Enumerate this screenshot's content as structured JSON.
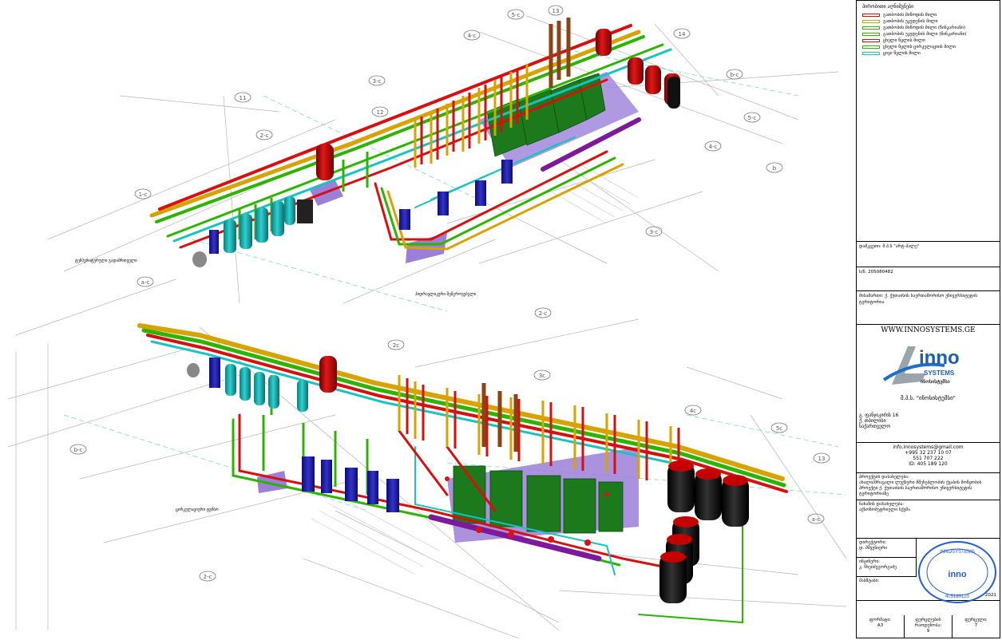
{
  "legend": {
    "title": "პირობითი აღნიშვნები",
    "items": [
      {
        "label": "გათბობის მიწოდის მილი",
        "color": "#d80f0f"
      },
      {
        "label": "გათბობის უკუდენის მილი",
        "color": "#d6a300"
      },
      {
        "label": "გათბობის მიწოდის მილი (წინკარიანი)",
        "color": "#2db400"
      },
      {
        "label": "გათბობის უკუდენის მილი (წინკარიანი)",
        "color": "#2db400"
      },
      {
        "label": "ცხელი წყლის მილი",
        "color": "#d80f0f"
      },
      {
        "label": "ცხელი წყლის ცირკულაციის მილი",
        "color": "#2db400"
      },
      {
        "label": "ცივი წყლის მილი",
        "color": "#19c3c3"
      }
    ]
  },
  "title_block": {
    "client": "დამკვეთი: შ.პ.ს \"არტ-პალე\"",
    "code": "ს/ნ. 205080482",
    "address": "მისამართი: ქ. ქუთაისის საერთაშორისო უნივერსიტეტის ტერიტორია",
    "website": "WWW.INNOSYSTEMS.GE",
    "logo_word": "inno",
    "logo_sub": "SYSTEMS",
    "logo_geo": "ინოსისტემსი",
    "company": "შ.პ.ს. \"ინოსისტემსი\"",
    "street": "გ. ფანჯიკიძის 16",
    "city": "ქ. თბილისი",
    "country": "საქართველო",
    "email": "info.innosystems@gmail.com",
    "phone1": "+995 32 237 10 07",
    "phone2": "551 707 222",
    "id": "ID: 405 189 120",
    "project_label": "პროექტის დასახელება:",
    "project_text": "ახალი/მრავალი ლუქსური მშენებლობის ქვაბის მოწყობის პროექტი ქ. ქუთაისის საერთაშორისო უნივერსიტეტის ტერიტორიაზე",
    "drawing_label": "ნახაზის დასახელება:",
    "drawing_text": "აქსონომეტრიული სქემა",
    "director_label": "დირექტორი:",
    "director_name": "დ. მშვენიერი",
    "engineer_label": "ინჟინერი:",
    "engineer_name": "კ. ჩხეიძეგორგაძე",
    "scale_label": "მასშტაბი:",
    "year": "2021",
    "format_label": "ფორმატი:",
    "format_value": "A3",
    "sheets_label": "ფურცლების რაოდენობა:",
    "sheets_value": "9",
    "sheet_label": "ფურცელი:",
    "sheet_value": "7",
    "stamp_text": "INNOSYSTEMS",
    "stamp_code": "405189120"
  },
  "drawing": {
    "grid_labels_top": [
      "5-c",
      "13",
      "4-c",
      "14",
      "3-c",
      "12",
      "2-c",
      "1-c",
      "11",
      "5-c",
      "4-c",
      "3-c",
      "2-c",
      "b-c",
      "a-c"
    ],
    "grid_labels_bottom": [
      "2c",
      "3c",
      "4c",
      "5c",
      "13",
      "b-c",
      "a-c",
      "2-c"
    ],
    "annotations": [
      "ტემპერატურული გადამრთველი",
      "ჰიდრავლიკური შემგროვებელი",
      "ცირკულაციური ტუმბო"
    ]
  }
}
